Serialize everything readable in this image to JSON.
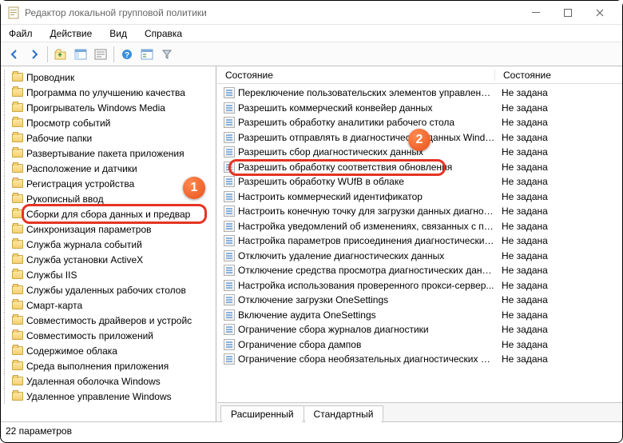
{
  "window": {
    "title": "Редактор локальной групповой политики"
  },
  "menu": {
    "file": "Файл",
    "action": "Действие",
    "view": "Вид",
    "help": "Справка"
  },
  "tree": {
    "items": [
      "Проводник",
      "Программа по улучшению качества",
      "Проигрыватель Windows Media",
      "Просмотр событий",
      "Рабочие папки",
      "Развертывание пакета приложения",
      "Расположение и датчики",
      "Регистрация устройства",
      "Рукописный ввод",
      "Сборки для сбора данных и предвар",
      "Синхронизация параметров",
      "Служба журнала событий",
      "Служба установки ActiveX",
      "Службы IIS",
      "Службы удаленных рабочих столов",
      "Смарт-карта",
      "Совместимость драйверов и устройс",
      "Совместимость приложений",
      "Содержимое облака",
      "Среда выполнения приложения",
      "Удаленная оболочка Windows",
      "Удаленное управление Windows"
    ],
    "selected_index": 9
  },
  "list": {
    "header_state": "Состояние",
    "header_status": "Состояние",
    "rows": [
      {
        "label": "Переключение пользовательских элементов управления...",
        "status": "Не задана"
      },
      {
        "label": "Разрешить коммерческий конвейер данных",
        "status": "Не задана"
      },
      {
        "label": "Разрешить обработку аналитики рабочего стола",
        "status": "Не задана"
      },
      {
        "label": "Разрешить отправлять в диагностических данных Windo...",
        "status": "Не задана"
      },
      {
        "label": "Разрешить сбор диагностических данных",
        "status": "Не задана"
      },
      {
        "label": "Разрешить обработку соответствия обновления",
        "status": "Не задана"
      },
      {
        "label": "Разрешить обработку WUfB в облаке",
        "status": "Не задана"
      },
      {
        "label": "Настроить коммерческий идентификатор",
        "status": "Не задана"
      },
      {
        "label": "Настроить конечную точку для загрузки данных диагнос...",
        "status": "Не задана"
      },
      {
        "label": "Настройка уведомлений об изменениях, связанных с пр...",
        "status": "Не задана"
      },
      {
        "label": "Настройка параметров присоединения диагностических ...",
        "status": "Не задана"
      },
      {
        "label": "Отключить удаление диагностических данных",
        "status": "Не задана"
      },
      {
        "label": "Отключение средства просмотра диагностических данных",
        "status": "Не задана"
      },
      {
        "label": "Настройка использования проверенного прокси-сервер...",
        "status": "Не задана"
      },
      {
        "label": "Отключение загрузки OneSettings",
        "status": "Не задана"
      },
      {
        "label": "Включение аудита OneSettings",
        "status": "Не задана"
      },
      {
        "label": "Ограничение сбора журналов диагностики",
        "status": "Не задана"
      },
      {
        "label": "Ограничение сбора дампов",
        "status": "Не задана"
      },
      {
        "label": "Ограничение сбора необязательных диагностических да...",
        "status": "Не задана"
      }
    ]
  },
  "tabs": {
    "extended": "Расширенный",
    "standard": "Стандартный"
  },
  "statusbar": {
    "text": "22 параметров"
  },
  "annotations": {
    "badge1": "1",
    "badge2": "2"
  }
}
